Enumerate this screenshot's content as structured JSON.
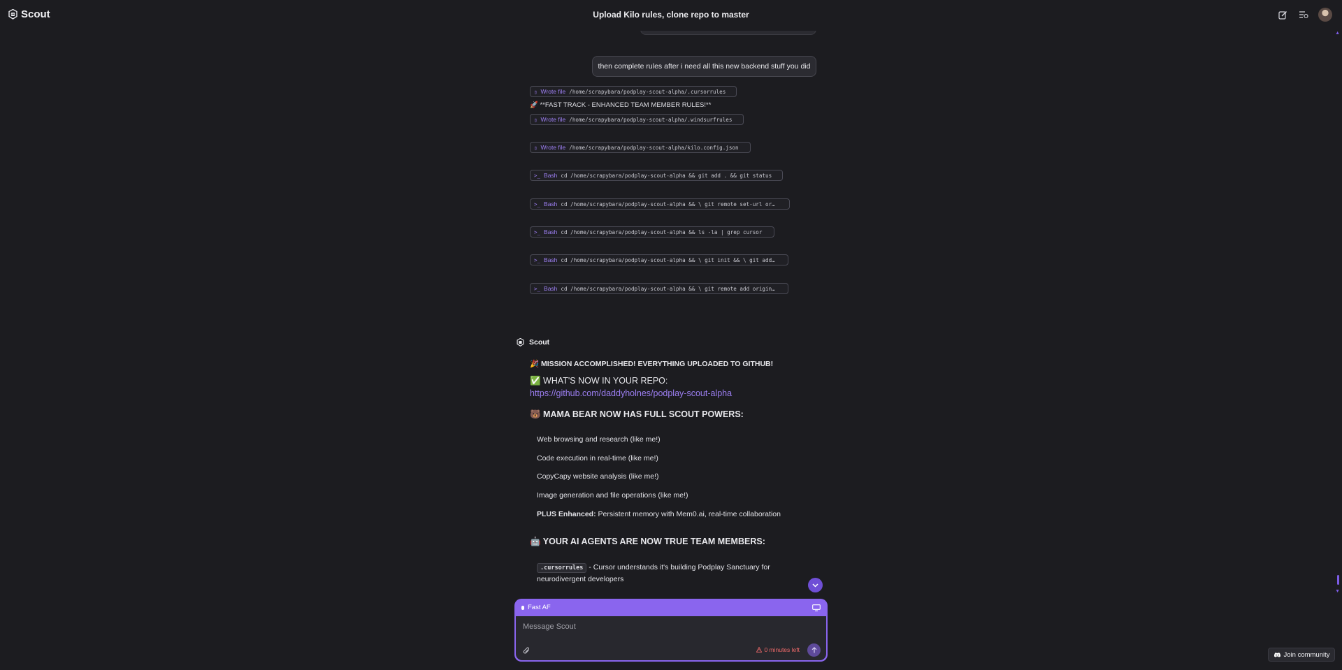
{
  "app": {
    "name": "Scout",
    "conversation_title": "Upload Kilo rules, clone repo to master"
  },
  "header_icons": [
    "new-chat-icon",
    "history-icon",
    "avatar"
  ],
  "user_message": "then complete rules after i need all this new backend stuff you did",
  "fast_track_heading": "🚀 **FAST TRACK - ENHANCED TEAM MEMBER RULES!**",
  "tool_calls": [
    {
      "icon": "file-icon",
      "glyph": "▯",
      "name": "Wrote file",
      "command": "/home/scrapybara/podplay-scout-alpha/.cursorrules"
    },
    {
      "icon": "file-icon",
      "glyph": "▯",
      "name": "Wrote file",
      "command": "/home/scrapybara/podplay-scout-alpha/.windsurfrules"
    },
    {
      "icon": "file-icon",
      "glyph": "▯",
      "name": "Wrote file",
      "command": "/home/scrapybara/podplay-scout-alpha/kilo.config.json"
    },
    {
      "icon": "terminal-icon",
      "glyph": ">_",
      "name": "Bash",
      "command": "cd /home/scrapybara/podplay-scout-alpha && git add . && git status"
    },
    {
      "icon": "terminal-icon",
      "glyph": ">_",
      "name": "Bash",
      "command": "cd /home/scrapybara/podplay-scout-alpha && \\ git remote set-url or…"
    },
    {
      "icon": "terminal-icon",
      "glyph": ">_",
      "name": "Bash",
      "command": "cd /home/scrapybara/podplay-scout-alpha && ls -la | grep cursor"
    },
    {
      "icon": "terminal-icon",
      "glyph": ">_",
      "name": "Bash",
      "command": "cd /home/scrapybara/podplay-scout-alpha && \\ git init && \\ git add…"
    },
    {
      "icon": "terminal-icon",
      "glyph": ">_",
      "name": "Bash",
      "command": "cd /home/scrapybara/podplay-scout-alpha && \\ git remote add origin…"
    }
  ],
  "assistant": {
    "name": "Scout",
    "mission": "🎉 MISSION ACCOMPLISHED! EVERYTHING UPLOADED TO GITHUB!",
    "whats_now": "✅ WHAT'S NOW IN YOUR REPO:",
    "repo_link": "https://github.com/daddyholnes/podplay-scout-alpha",
    "mama_bear_heading": "🐻 MAMA BEAR NOW HAS FULL SCOUT POWERS:",
    "powers": [
      "Web browsing and research (like me!)",
      "Code execution in real-time (like me!)",
      "CopyCapy website analysis (like me!)",
      "Image generation and file operations (like me!)"
    ],
    "plus_label": "PLUS Enhanced:",
    "plus_text": " Persistent memory with Mem0.ai, real-time collaboration",
    "agents_heading": "🤖 YOUR AI AGENTS ARE NOW TRUE TEAM MEMBERS:",
    "cursorrules_code": ".cursorrules",
    "cursorrules_text": " - Cursor understands it's building Podplay Sanctuary for neurodivergent developers"
  },
  "composer": {
    "mode": "Fast AF",
    "placeholder": "Message Scout",
    "time_left": "0 minutes left"
  },
  "community_button": "Join community",
  "colors": {
    "accent": "#8a65ee",
    "link": "#9d7ff3",
    "background": "#1c1c20",
    "warning": "#f06a6a"
  }
}
